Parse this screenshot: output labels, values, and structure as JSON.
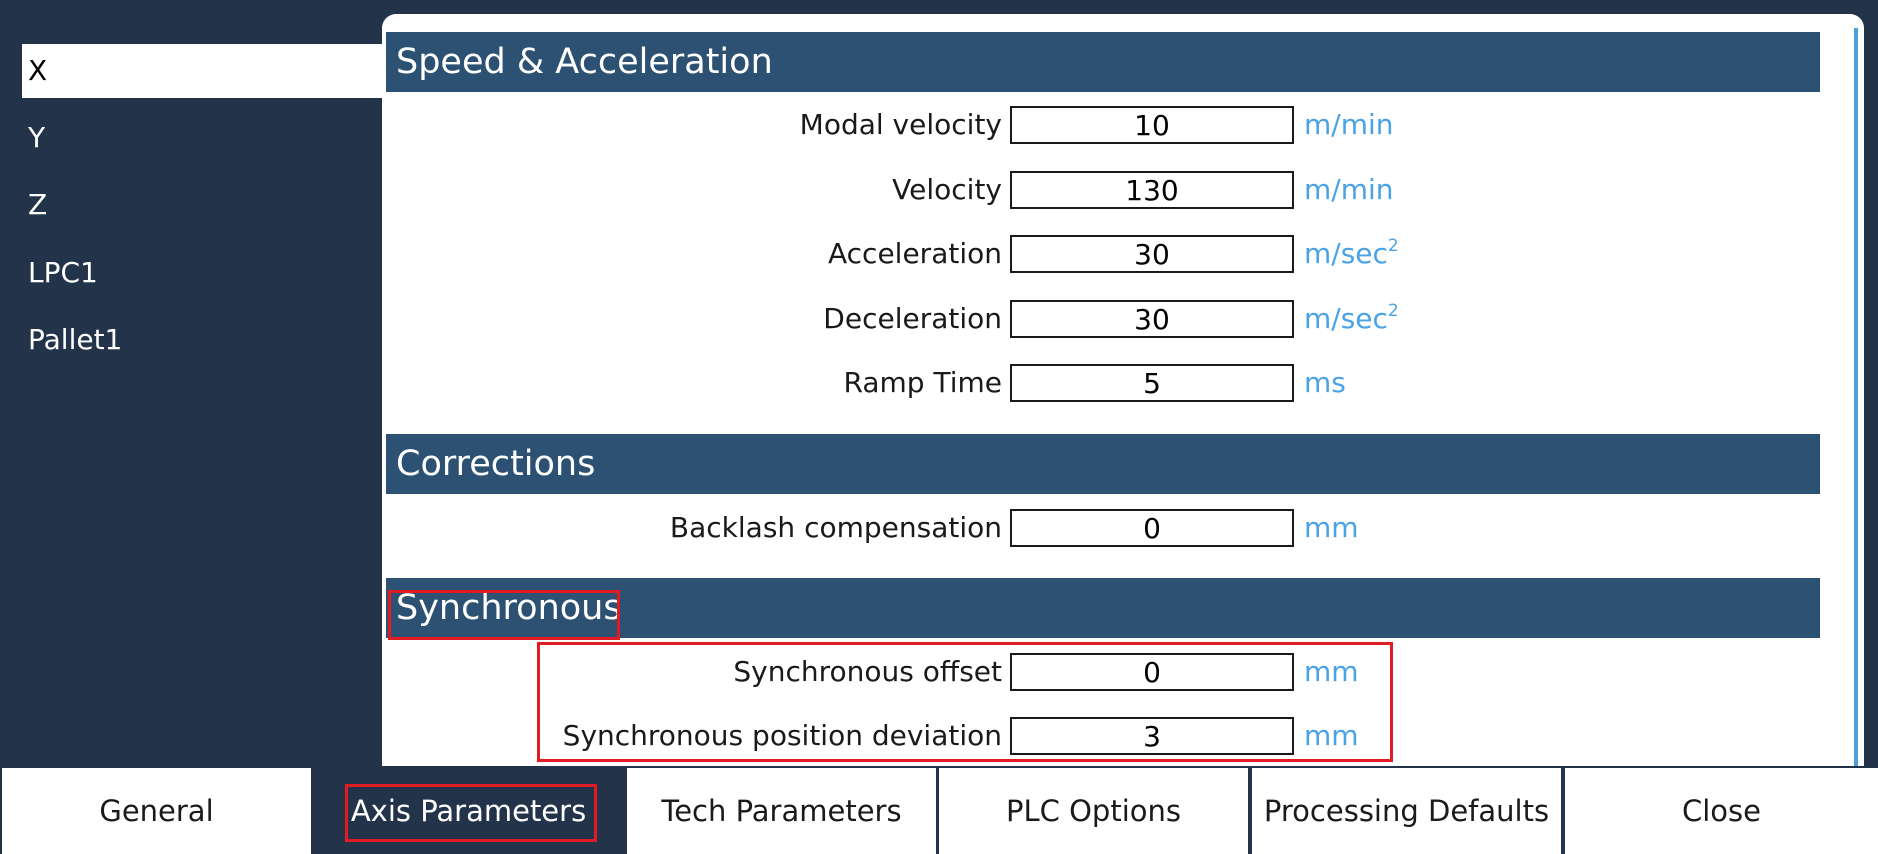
{
  "sidebar": {
    "items": [
      {
        "label": "X",
        "selected": true
      },
      {
        "label": "Y"
      },
      {
        "label": "Z"
      },
      {
        "label": "LPC1"
      },
      {
        "label": "Pallet1"
      }
    ]
  },
  "sections": {
    "speed": {
      "title": "Speed & Acceleration",
      "rows": [
        {
          "label": "Modal velocity",
          "value": "10",
          "unit": "m/min"
        },
        {
          "label": "Velocity",
          "value": "130",
          "unit": "m/min"
        },
        {
          "label": "Acceleration",
          "value": "30",
          "unit": "m/sec",
          "unit_sup": "2"
        },
        {
          "label": "Deceleration",
          "value": "30",
          "unit": "m/sec",
          "unit_sup": "2"
        },
        {
          "label": "Ramp Time",
          "value": "5",
          "unit": "ms"
        }
      ]
    },
    "corrections": {
      "title": "Corrections",
      "rows": [
        {
          "label": "Backlash compensation",
          "value": "0",
          "unit": "mm"
        }
      ]
    },
    "synchronous": {
      "title": "Synchronous",
      "rows": [
        {
          "label": "Synchronous offset",
          "value": "0",
          "unit": "mm"
        },
        {
          "label": "Synchronous position deviation",
          "value": "3",
          "unit": "mm"
        }
      ]
    }
  },
  "tabs": [
    {
      "label": "General"
    },
    {
      "label": "Axis Parameters",
      "active": true
    },
    {
      "label": "Tech Parameters"
    },
    {
      "label": "PLC Options"
    },
    {
      "label": "Processing Defaults"
    },
    {
      "label": "Close"
    }
  ],
  "colors": {
    "background": "#23344a",
    "section_header": "#2c5172",
    "unit_text": "#4aa3e6",
    "highlight": "#e01b24"
  }
}
